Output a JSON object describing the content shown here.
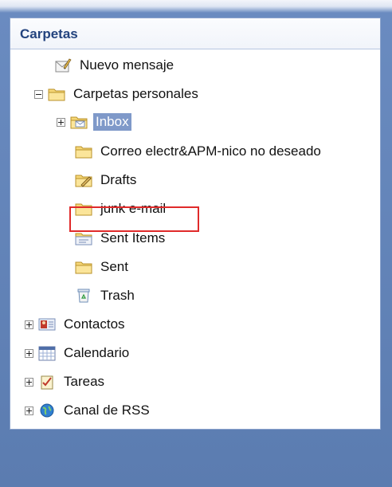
{
  "panel": {
    "title": "Carpetas"
  },
  "tree": {
    "new_message": "Nuevo mensaje",
    "personal_folders": "Carpetas personales",
    "inbox": "Inbox",
    "junk_long": "Correo electr&APM-nico no deseado",
    "drafts": "Drafts",
    "junk": "junk e-mail",
    "sent_items": "Sent Items",
    "sent": "Sent",
    "trash": "Trash",
    "contacts": "Contactos",
    "calendar": "Calendario",
    "tasks": "Tareas",
    "rss": "Canal de RSS"
  },
  "state": {
    "selected": "inbox",
    "highlighted": "junk"
  }
}
